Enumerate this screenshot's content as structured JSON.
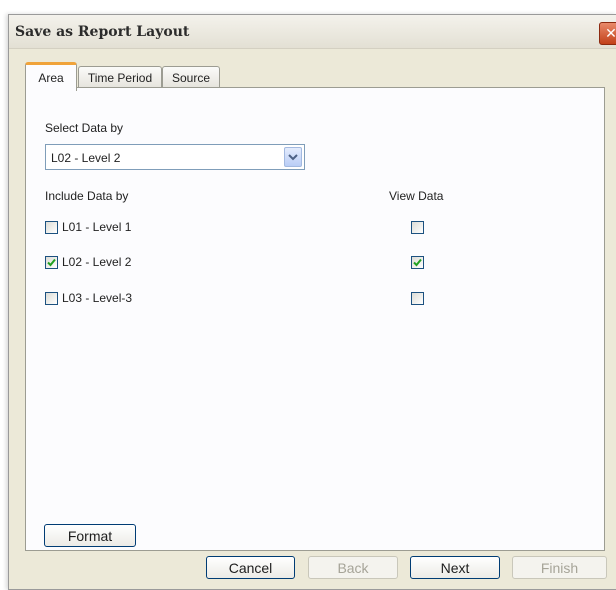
{
  "window": {
    "title": "Save as Report Layout",
    "close_icon": "close-icon"
  },
  "tabs": [
    {
      "label": "Area",
      "active": true
    },
    {
      "label": "Time Period",
      "active": false
    },
    {
      "label": "Source",
      "active": false
    }
  ],
  "area": {
    "select_label": "Select Data by",
    "select_value": "L02 - Level 2",
    "include_label": "Include Data by",
    "view_label": "View Data",
    "rows": [
      {
        "label": "L01 - Level 1",
        "include": false,
        "view": false
      },
      {
        "label": "L02 - Level 2",
        "include": true,
        "view": true
      },
      {
        "label": "L03 - Level-3",
        "include": false,
        "view": false
      }
    ],
    "format_label": "Format"
  },
  "footer": {
    "cancel": "Cancel",
    "back": "Back",
    "next": "Next",
    "finish": "Finish"
  },
  "colors": {
    "check": "#21a121",
    "tab_accent": "#f0a33a",
    "close": "#c2401a"
  }
}
